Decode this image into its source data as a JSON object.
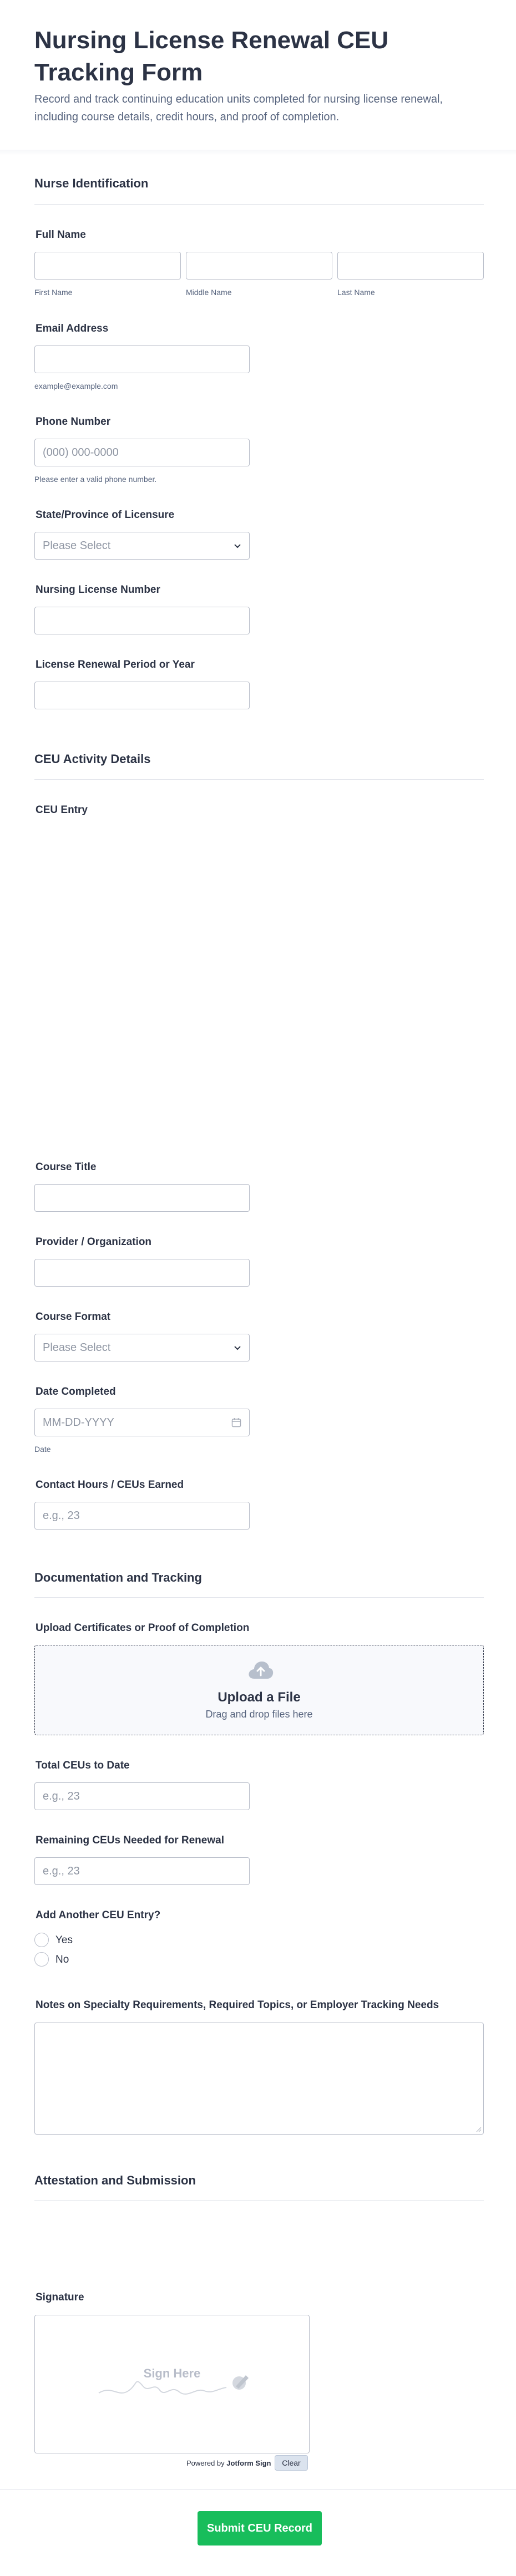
{
  "header": {
    "title": "Nursing License Renewal CEU Tracking Form",
    "description": "Record and track continuing education units completed for nursing license renewal, including course details, credit hours, and proof of completion."
  },
  "sections": {
    "nurse_identification": "Nurse Identification",
    "ceu_activity": "CEU Activity Details",
    "documentation": "Documentation and Tracking",
    "attestation": "Attestation and Submission"
  },
  "fields": {
    "full_name": {
      "label": "Full Name",
      "first": "First Name",
      "middle": "Middle Name",
      "last": "Last Name"
    },
    "email": {
      "label": "Email Address",
      "sublabel": "example@example.com"
    },
    "phone": {
      "label": "Phone Number",
      "placeholder": "(000) 000-0000",
      "sublabel": "Please enter a valid phone number."
    },
    "state": {
      "label": "State/Province of Licensure",
      "placeholder": "Please Select"
    },
    "license_number": {
      "label": "Nursing License Number"
    },
    "renewal_period": {
      "label": "License Renewal Period or Year"
    },
    "ceu_entry": {
      "label": "CEU Entry"
    },
    "course_title": {
      "label": "Course Title"
    },
    "provider": {
      "label": "Provider / Organization"
    },
    "course_format": {
      "label": "Course Format",
      "placeholder": "Please Select"
    },
    "date_completed": {
      "label": "Date Completed",
      "placeholder": "MM-DD-YYYY",
      "sublabel": "Date"
    },
    "contact_hours": {
      "label": "Contact Hours / CEUs Earned",
      "placeholder": "e.g., 23"
    },
    "upload": {
      "label": "Upload Certificates or Proof of Completion",
      "title": "Upload a File",
      "subtitle": "Drag and drop files here"
    },
    "total_ceus": {
      "label": "Total CEUs to Date",
      "placeholder": "e.g., 23"
    },
    "remaining_ceus": {
      "label": "Remaining CEUs Needed for Renewal",
      "placeholder": "e.g., 23"
    },
    "add_another": {
      "label": "Add Another CEU Entry?",
      "options": [
        "Yes",
        "No"
      ]
    },
    "notes": {
      "label": "Notes on Specialty Requirements, Required Topics, or Employer Tracking Needs"
    },
    "signature": {
      "label": "Signature",
      "placeholder": "Sign Here",
      "powered_prefix": "Powered by",
      "powered_brand": "Jotform Sign",
      "clear": "Clear"
    }
  },
  "submit": {
    "label": "Submit CEU Record"
  },
  "colors": {
    "accent": "#18bd5b",
    "text": "#2c3345",
    "muted": "#57647e",
    "border": "#b8bdc9"
  },
  "icons": [
    "chevron-down-icon",
    "calendar-icon",
    "cloud-upload-icon",
    "signature-pen-icon",
    "resize-handle-icon"
  ]
}
